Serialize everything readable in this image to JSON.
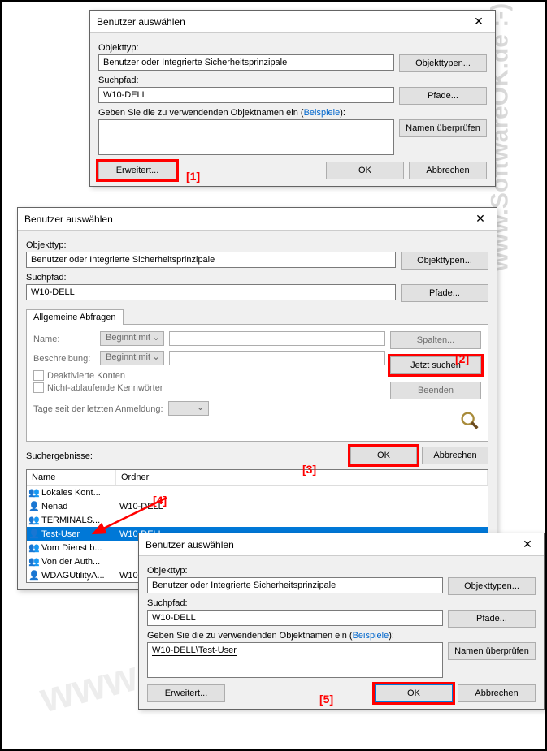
{
  "watermark_text": "www.SoftwareOK.de  :-)",
  "annotations": {
    "a1": "[1]",
    "a2": "[2]",
    "a3": "[3]",
    "a4": "[4]",
    "a5": "[5]"
  },
  "common": {
    "title": "Benutzer auswählen",
    "objtype_label": "Objekttyp:",
    "objtype_value": "Benutzer oder Integrierte Sicherheitsprinzipale",
    "objtype_btn": "Objekttypen...",
    "searchpath_label": "Suchpfad:",
    "searchpath_value": "W10-DELL",
    "paths_btn": "Pfade...",
    "enter_names_prefix": "Geben Sie die zu verwendenden Objektnamen ein (",
    "examples_link": "Beispiele",
    "enter_names_suffix": "):",
    "check_names_btn": "Namen überprüfen",
    "advanced_btn": "Erweitert...",
    "ok": "OK",
    "cancel": "Abbrechen"
  },
  "d2": {
    "tab": "Allgemeine Abfragen",
    "name_label": "Name:",
    "desc_label": "Beschreibung:",
    "begins_with": "Beginnt mit",
    "deactivated": "Deaktivierte Konten",
    "nonexpiring": "Nicht-ablaufende Kennwörter",
    "days_label": "Tage seit der letzten Anmeldung:",
    "columns_btn": "Spalten...",
    "search_now_btn": "Jetzt suchen",
    "stop_btn": "Beenden",
    "results_label": "Suchergebnisse:",
    "col_name": "Name",
    "col_folder": "Ordner",
    "rows": [
      {
        "name": "Lokales Kont...",
        "folder": ""
      },
      {
        "name": "Nenad",
        "folder": "W10-DELL"
      },
      {
        "name": "TERMINALS...",
        "folder": ""
      },
      {
        "name": "Test-User",
        "folder": "W10-DELL"
      },
      {
        "name": "Vom Dienst b...",
        "folder": ""
      },
      {
        "name": "Von der Auth...",
        "folder": ""
      },
      {
        "name": "WDAGUtilityA...",
        "folder": "W10-DELL"
      }
    ]
  },
  "d3": {
    "object_names": "W10-DELL\\Test-User"
  }
}
